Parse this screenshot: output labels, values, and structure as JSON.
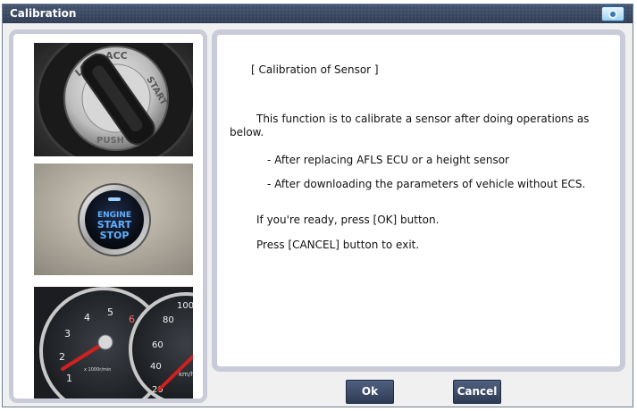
{
  "window": {
    "title": "Calibration",
    "title_icon": "camera-icon"
  },
  "images": [
    {
      "name": "ignition-key-lock",
      "label_lock": "LOCK",
      "label_acc": "ACC",
      "label_start": "START",
      "label_push": "PUSH"
    },
    {
      "name": "engine-start-stop-button",
      "line1": "ENGINE",
      "line2": "START",
      "line3": "STOP"
    },
    {
      "name": "instrument-cluster-gauges",
      "rpm_ticks": [
        "1",
        "2",
        "3",
        "4",
        "5",
        "6"
      ],
      "rpm_unit": "x 1000r/min",
      "speed_ticks": [
        "20",
        "40",
        "60",
        "80",
        "100"
      ],
      "speed_unit": "km/h"
    }
  ],
  "message": {
    "heading": "[ Calibration of Sensor ]",
    "intro": "This function is to calibrate a sensor after doing operations as below.",
    "items": [
      "- After replacing AFLS ECU or a height sensor",
      "- After downloading the parameters of vehicle without ECS."
    ],
    "ready": "If you're ready, press [OK] button.",
    "exit": "Press [CANCEL] button to exit."
  },
  "buttons": {
    "ok": "Ok",
    "cancel": "Cancel"
  },
  "colors": {
    "titlebar": "#3a4862",
    "panel_border": "#c9ccd8",
    "button": "#3b4966",
    "start_button_glow": "#5fb0ff",
    "needle": "#d02020"
  }
}
